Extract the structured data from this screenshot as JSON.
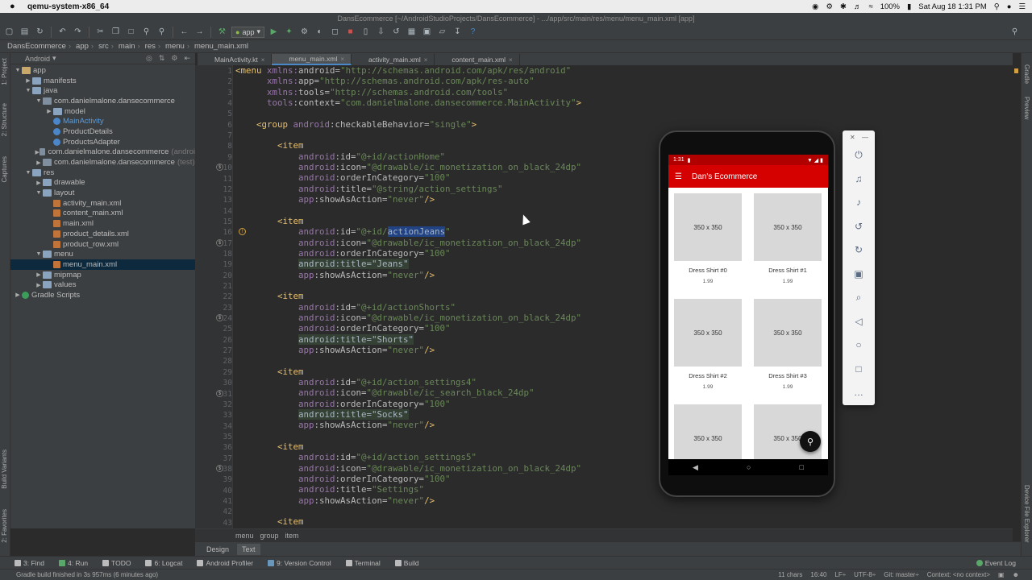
{
  "mac_menubar": {
    "apple": "",
    "app_name": "qemu-system-x86_64",
    "status_text": "100%",
    "datetime": "Sat Aug 18  1:31 PM"
  },
  "window": {
    "title": "DansEcommerce [~/AndroidStudioProjects/DansEcommerce] - .../app/src/main/res/menu/menu_main.xml [app]"
  },
  "toolbar": {
    "run_config": "app"
  },
  "navbar": {
    "crumbs": [
      "DansEcommerce",
      "app",
      "src",
      "main",
      "res",
      "menu",
      "menu_main.xml"
    ]
  },
  "left_tabs": [
    "1: Project",
    "2: Structure",
    "Captures",
    "Build Variants",
    "2: Favorites"
  ],
  "right_tabs": [
    "Gradle",
    "Preview",
    "Device File Explorer"
  ],
  "project": {
    "view_mode": "Android",
    "tree": [
      {
        "label": "app",
        "depth": 0,
        "arrow": "▼",
        "icon": "folder-y"
      },
      {
        "label": "manifests",
        "depth": 1,
        "arrow": "▶",
        "icon": "folder"
      },
      {
        "label": "java",
        "depth": 1,
        "arrow": "▼",
        "icon": "folder"
      },
      {
        "label": "com.danielmalone.dansecommerce",
        "depth": 2,
        "arrow": "▼",
        "icon": "pkg"
      },
      {
        "label": "model",
        "depth": 3,
        "arrow": "▶",
        "icon": "folder"
      },
      {
        "label": "MainActivity",
        "depth": 3,
        "arrow": "",
        "icon": "cls",
        "blue": true
      },
      {
        "label": "ProductDetails",
        "depth": 3,
        "arrow": "",
        "icon": "cls"
      },
      {
        "label": "ProductsAdapter",
        "depth": 3,
        "arrow": "",
        "icon": "cls"
      },
      {
        "label": "com.danielmalone.dansecommerce",
        "depth": 2,
        "arrow": "▶",
        "icon": "pkg",
        "note": "(androi"
      },
      {
        "label": "com.danielmalone.dansecommerce",
        "depth": 2,
        "arrow": "▶",
        "icon": "pkg",
        "note": "(test)"
      },
      {
        "label": "res",
        "depth": 1,
        "arrow": "▼",
        "icon": "folder"
      },
      {
        "label": "drawable",
        "depth": 2,
        "arrow": "▶",
        "icon": "folder"
      },
      {
        "label": "layout",
        "depth": 2,
        "arrow": "▼",
        "icon": "folder"
      },
      {
        "label": "activity_main.xml",
        "depth": 3,
        "arrow": "",
        "icon": "xml"
      },
      {
        "label": "content_main.xml",
        "depth": 3,
        "arrow": "",
        "icon": "xml"
      },
      {
        "label": "main.xml",
        "depth": 3,
        "arrow": "",
        "icon": "xml"
      },
      {
        "label": "product_details.xml",
        "depth": 3,
        "arrow": "",
        "icon": "xml"
      },
      {
        "label": "product_row.xml",
        "depth": 3,
        "arrow": "",
        "icon": "xml"
      },
      {
        "label": "menu",
        "depth": 2,
        "arrow": "▼",
        "icon": "folder"
      },
      {
        "label": "menu_main.xml",
        "depth": 3,
        "arrow": "",
        "icon": "xml",
        "selected": true
      },
      {
        "label": "mipmap",
        "depth": 2,
        "arrow": "▶",
        "icon": "folder"
      },
      {
        "label": "values",
        "depth": 2,
        "arrow": "▶",
        "icon": "folder"
      },
      {
        "label": "Gradle Scripts",
        "depth": 0,
        "arrow": "▶",
        "icon": "gradle"
      }
    ]
  },
  "editor_tabs": [
    {
      "label": "MainActivity.kt",
      "active": false
    },
    {
      "label": "menu_main.xml",
      "active": true
    },
    {
      "label": "activity_main.xml",
      "active": false
    },
    {
      "label": "content_main.xml",
      "active": false
    }
  ],
  "code_lines": [
    [
      [
        "k",
        "<menu "
      ],
      [
        "ns",
        "xmlns:"
      ],
      [
        "a",
        "android"
      ],
      [
        "a",
        "="
      ],
      [
        "s",
        "\"http://schemas.android.com/apk/res/android\""
      ]
    ],
    [
      [
        "a",
        "      "
      ],
      [
        "ns",
        "xmlns:"
      ],
      [
        "a",
        "app"
      ],
      [
        "a",
        "="
      ],
      [
        "s",
        "\"http://schemas.android.com/apk/res-auto\""
      ]
    ],
    [
      [
        "a",
        "      "
      ],
      [
        "ns",
        "xmlns:"
      ],
      [
        "a",
        "tools"
      ],
      [
        "a",
        "="
      ],
      [
        "s",
        "\"http://schemas.android.com/tools\""
      ]
    ],
    [
      [
        "a",
        "      "
      ],
      [
        "ns",
        "tools"
      ],
      [
        "a",
        ":context="
      ],
      [
        "s",
        "\"com.danielmalone.dansecommerce.MainActivity\""
      ],
      [
        "k",
        ">"
      ]
    ],
    [],
    [
      [
        "a",
        "    "
      ],
      [
        "k",
        "<group "
      ],
      [
        "ns",
        "android"
      ],
      [
        "a",
        ":checkableBehavior="
      ],
      [
        "s",
        "\"single\""
      ],
      [
        "k",
        ">"
      ]
    ],
    [],
    [
      [
        "a",
        "        "
      ],
      [
        "k",
        "<item"
      ]
    ],
    [
      [
        "a",
        "            "
      ],
      [
        "ns",
        "android"
      ],
      [
        "a",
        ":id="
      ],
      [
        "s",
        "\"@+id/actionHome\""
      ]
    ],
    [
      [
        "a",
        "            "
      ],
      [
        "ns",
        "android"
      ],
      [
        "a",
        ":icon="
      ],
      [
        "s",
        "\"@drawable/ic_monetization_on_black_24dp\""
      ]
    ],
    [
      [
        "a",
        "            "
      ],
      [
        "ns",
        "android"
      ],
      [
        "a",
        ":orderInCategory="
      ],
      [
        "s",
        "\"100\""
      ]
    ],
    [
      [
        "a",
        "            "
      ],
      [
        "ns",
        "android"
      ],
      [
        "a",
        ":title="
      ],
      [
        "s",
        "\"@string/action_settings\""
      ]
    ],
    [
      [
        "a",
        "            "
      ],
      [
        "ns",
        "app"
      ],
      [
        "a",
        ":showAsAction="
      ],
      [
        "s",
        "\"never\""
      ],
      [
        "k",
        "/>"
      ]
    ],
    [],
    [
      [
        "a",
        "        "
      ],
      [
        "k",
        "<item"
      ]
    ],
    [
      [
        "a",
        "            "
      ],
      [
        "ns",
        "android"
      ],
      [
        "a",
        ":id="
      ],
      [
        "s",
        "\"@+id/"
      ],
      [
        "sel",
        "actionJeans"
      ],
      [
        "s",
        "\""
      ]
    ],
    [
      [
        "a",
        "            "
      ],
      [
        "ns",
        "android"
      ],
      [
        "a",
        ":icon="
      ],
      [
        "s",
        "\"@drawable/ic_monetization_on_black_24dp\""
      ]
    ],
    [
      [
        "a",
        "            "
      ],
      [
        "ns",
        "android"
      ],
      [
        "a",
        ":orderInCategory="
      ],
      [
        "s",
        "\"100\""
      ]
    ],
    [
      [
        "a",
        "            "
      ],
      [
        "hl",
        "android:title=\"Jeans\""
      ]
    ],
    [
      [
        "a",
        "            "
      ],
      [
        "ns",
        "app"
      ],
      [
        "a",
        ":showAsAction="
      ],
      [
        "s",
        "\"never\""
      ],
      [
        "k",
        "/>"
      ]
    ],
    [],
    [
      [
        "a",
        "        "
      ],
      [
        "k",
        "<item"
      ]
    ],
    [
      [
        "a",
        "            "
      ],
      [
        "ns",
        "android"
      ],
      [
        "a",
        ":id="
      ],
      [
        "s",
        "\"@+id/actionShorts\""
      ]
    ],
    [
      [
        "a",
        "            "
      ],
      [
        "ns",
        "android"
      ],
      [
        "a",
        ":icon="
      ],
      [
        "s",
        "\"@drawable/ic_monetization_on_black_24dp\""
      ]
    ],
    [
      [
        "a",
        "            "
      ],
      [
        "ns",
        "android"
      ],
      [
        "a",
        ":orderInCategory="
      ],
      [
        "s",
        "\"100\""
      ]
    ],
    [
      [
        "a",
        "            "
      ],
      [
        "hl",
        "android:title=\"Shorts\""
      ]
    ],
    [
      [
        "a",
        "            "
      ],
      [
        "ns",
        "app"
      ],
      [
        "a",
        ":showAsAction="
      ],
      [
        "s",
        "\"never\""
      ],
      [
        "k",
        "/>"
      ]
    ],
    [],
    [
      [
        "a",
        "        "
      ],
      [
        "k",
        "<item"
      ]
    ],
    [
      [
        "a",
        "            "
      ],
      [
        "ns",
        "android"
      ],
      [
        "a",
        ":id="
      ],
      [
        "s",
        "\"@+id/action_settings4\""
      ]
    ],
    [
      [
        "a",
        "            "
      ],
      [
        "ns",
        "android"
      ],
      [
        "a",
        ":icon="
      ],
      [
        "s",
        "\"@drawable/ic_search_black_24dp\""
      ]
    ],
    [
      [
        "a",
        "            "
      ],
      [
        "ns",
        "android"
      ],
      [
        "a",
        ":orderInCategory="
      ],
      [
        "s",
        "\"100\""
      ]
    ],
    [
      [
        "a",
        "            "
      ],
      [
        "hl",
        "android:title=\"Socks\""
      ]
    ],
    [
      [
        "a",
        "            "
      ],
      [
        "ns",
        "app"
      ],
      [
        "a",
        ":showAsAction="
      ],
      [
        "s",
        "\"never\""
      ],
      [
        "k",
        "/>"
      ]
    ],
    [],
    [
      [
        "a",
        "        "
      ],
      [
        "k",
        "<item"
      ]
    ],
    [
      [
        "a",
        "            "
      ],
      [
        "ns",
        "android"
      ],
      [
        "a",
        ":id="
      ],
      [
        "s",
        "\"@+id/action_settings5\""
      ]
    ],
    [
      [
        "a",
        "            "
      ],
      [
        "ns",
        "android"
      ],
      [
        "a",
        ":icon="
      ],
      [
        "s",
        "\"@drawable/ic_monetization_on_black_24dp\""
      ]
    ],
    [
      [
        "a",
        "            "
      ],
      [
        "ns",
        "android"
      ],
      [
        "a",
        ":orderInCategory="
      ],
      [
        "s",
        "\"100\""
      ]
    ],
    [
      [
        "a",
        "            "
      ],
      [
        "ns",
        "android"
      ],
      [
        "a",
        ":title="
      ],
      [
        "s",
        "\"Settings\""
      ]
    ],
    [
      [
        "a",
        "            "
      ],
      [
        "ns",
        "app"
      ],
      [
        "a",
        ":showAsAction="
      ],
      [
        "s",
        "\"never\""
      ],
      [
        "k",
        "/>"
      ]
    ],
    [],
    [
      [
        "a",
        "        "
      ],
      [
        "k",
        "<item"
      ]
    ]
  ],
  "gutter_icon_lines": [
    9,
    16,
    23,
    30,
    37
  ],
  "xml_path": [
    "menu",
    "group",
    "item"
  ],
  "design_tabs": [
    {
      "label": "Design",
      "active": false
    },
    {
      "label": "Text",
      "active": true
    }
  ],
  "tool_windows": [
    {
      "label": "3: Find",
      "color": "#bbbbbb"
    },
    {
      "label": "4: Run",
      "color": "#59a869"
    },
    {
      "label": "TODO",
      "color": "#bbbbbb"
    },
    {
      "label": "6: Logcat",
      "color": "#bbbbbb"
    },
    {
      "label": "Android Profiler",
      "color": "#bbbbbb"
    },
    {
      "label": "9: Version Control",
      "color": "#6897bb"
    },
    {
      "label": "Terminal",
      "color": "#bbbbbb"
    },
    {
      "label": "Build",
      "color": "#bbbbbb"
    }
  ],
  "event_log": "Event Log",
  "status": {
    "message": "Gradle build finished in 3s 957ms (6 minutes ago)",
    "chars": "11 chars",
    "position": "16:40",
    "line_sep": "LF÷",
    "encoding": "UTF-8÷",
    "git": "Git: master÷",
    "context": "Context: <no context>"
  },
  "emulator": {
    "time": "1:31",
    "app_title": "Dan's Ecommerce",
    "products": [
      {
        "placeholder": "350 x 350",
        "name": "Dress Shirt #0",
        "price": "1.99"
      },
      {
        "placeholder": "350 x 350",
        "name": "Dress Shirt #1",
        "price": "1.99"
      },
      {
        "placeholder": "350 x 350",
        "name": "Dress Shirt #2",
        "price": "1.99"
      },
      {
        "placeholder": "350 x 350",
        "name": "Dress Shirt #3",
        "price": "1.99"
      },
      {
        "placeholder": "350 x 350",
        "name": "",
        "price": ""
      },
      {
        "placeholder": "350 x 350",
        "name": "",
        "price": ""
      }
    ],
    "controls": [
      "power-icon",
      "volume-up-icon",
      "volume-down-icon",
      "rotate-left-icon",
      "rotate-right-icon",
      "camera-icon",
      "zoom-icon",
      "back-icon",
      "home-icon",
      "overview-icon",
      "more-icon"
    ]
  },
  "colors": {
    "accent": "#4a88c7",
    "app_bar": "#d50000",
    "status_bar": "#b00000"
  }
}
